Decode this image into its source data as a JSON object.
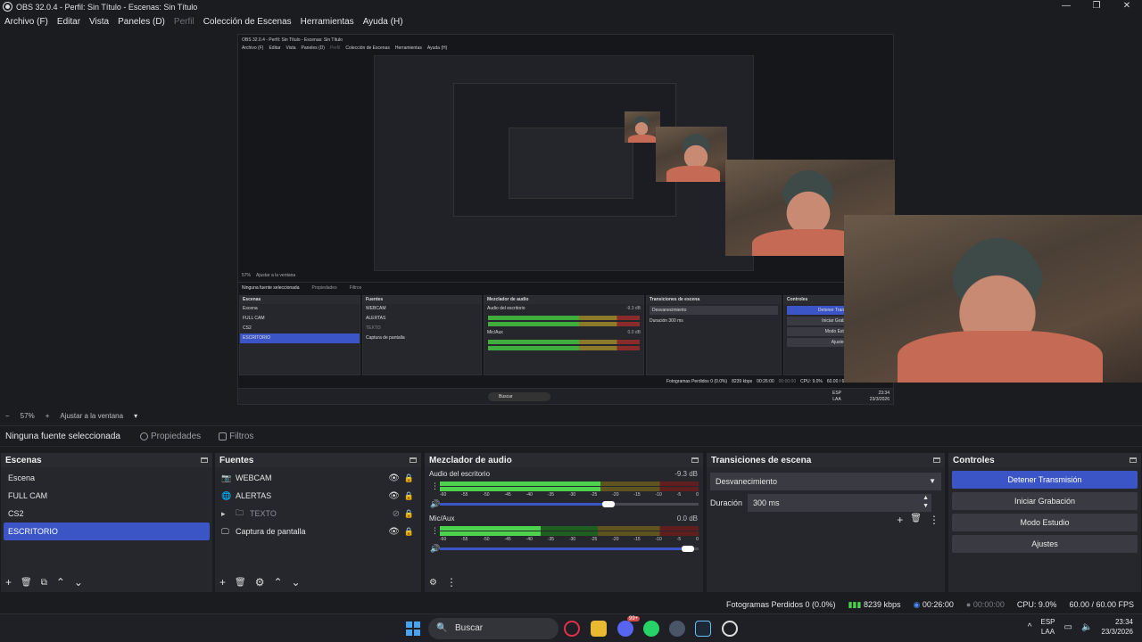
{
  "window": {
    "title": "OBS 32.0.4 - Perfil: Sin Título - Escenas: Sin Título",
    "controls": [
      "—",
      "❐",
      "✕"
    ]
  },
  "menu": [
    {
      "label": "Archivo (F)",
      "enabled": true
    },
    {
      "label": "Editar",
      "enabled": true
    },
    {
      "label": "Vista",
      "enabled": true
    },
    {
      "label": "Paneles (D)",
      "enabled": true
    },
    {
      "label": "Perfil",
      "enabled": false
    },
    {
      "label": "Colección de Escenas",
      "enabled": true
    },
    {
      "label": "Herramientas",
      "enabled": true
    },
    {
      "label": "Ayuda (H)",
      "enabled": true
    }
  ],
  "zoom": {
    "minus": "−",
    "value": "57%",
    "plus": "+",
    "fit_label": "Ajustar a la ventana",
    "caret": "▾"
  },
  "source_toolbar": {
    "no_source": "Ninguna fuente seleccionada",
    "properties": "Propiedades",
    "filters": "Filtros"
  },
  "scenes": {
    "title": "Escenas",
    "items": [
      {
        "label": "Escena",
        "selected": false
      },
      {
        "label": "FULL CAM",
        "selected": false
      },
      {
        "label": "CS2",
        "selected": false
      },
      {
        "label": "ESCRITORIO",
        "selected": true
      }
    ],
    "footer": [
      "+",
      "🗑",
      "⧉",
      "⌃",
      "⌄"
    ]
  },
  "sources": {
    "title": "Fuentes",
    "items": [
      {
        "label": "WEBCAM",
        "icon": "camera-icon",
        "glyph": "📷",
        "visible": true,
        "group": false
      },
      {
        "label": "ALERTAS",
        "icon": "globe-icon",
        "glyph": "🌐",
        "visible": true,
        "group": false
      },
      {
        "label": "TEXTO",
        "icon": "folder-icon",
        "glyph": "🗀",
        "visible": false,
        "group": true
      },
      {
        "label": "Captura de pantalla",
        "icon": "monitor-icon",
        "glyph": "🖵",
        "visible": true,
        "group": false
      }
    ],
    "footer": [
      "+",
      "🗑",
      "⚙",
      "⌃",
      "⌄"
    ]
  },
  "mixer": {
    "title": "Mezclador de audio",
    "ticks": [
      "-60",
      "-55",
      "-50",
      "-45",
      "-40",
      "-35",
      "-30",
      "-25",
      "-20",
      "-15",
      "-10",
      "-5",
      "0"
    ],
    "channels": [
      {
        "name": "Audio del escritorio",
        "db": "-9.3 dB",
        "level": 0.62,
        "volume": 0.65
      },
      {
        "name": "Mic/Aux",
        "db": "0.0 dB",
        "level": 0.39,
        "volume": 0.96
      }
    ],
    "footer": [
      "⚙",
      "⋮"
    ]
  },
  "transitions": {
    "title": "Transiciones de escena",
    "selected": "Desvanecimiento",
    "duration_label": "Duración",
    "duration_value": "300 ms",
    "tools": [
      "+",
      "🗑",
      "⋮"
    ]
  },
  "controls": {
    "title": "Controles",
    "buttons": [
      {
        "label": "Detener Transmisión",
        "active": true
      },
      {
        "label": "Iniciar Grabación",
        "active": false
      },
      {
        "label": "Modo Estudio",
        "active": false
      },
      {
        "label": "Ajustes",
        "active": false
      }
    ]
  },
  "status": {
    "dropped": "Fotogramas Perdidos 0 (0.0%)",
    "bitrate": "8239 kbps",
    "stream_time": "00:26:00",
    "rec_time": "00:00:00",
    "cpu": "CPU: 9.0%",
    "fps": "60.00 / 60.00 FPS"
  },
  "taskbar": {
    "search": "Buscar",
    "lang_top": "ESP",
    "lang_bottom": "LAA",
    "time": "23:34",
    "date": "23/3/2026",
    "tray_caret": "^",
    "badge": "99+"
  },
  "colors": {
    "accent": "#3b55c6",
    "meter_green": "#4cd24c",
    "meter_yellow": "#8c7a2a",
    "meter_red": "#8a2b2b",
    "background": "#1b1c20",
    "panel": "#26272d"
  },
  "nested_preview": {
    "title": "OBS 32.0.4 - Perfil: Sin Título - Escenas: Sin Título",
    "menu": [
      "Archivo (F)",
      "Editar",
      "Vista",
      "Paneles (D)",
      "Perfil",
      "Colección de Escenas",
      "Herramientas",
      "Ayuda (H)"
    ],
    "zoom": "57%",
    "zoom_fit": "Ajustar a la ventana",
    "no_source": "Ninguna fuente seleccionada",
    "properties": "Propiedades",
    "filters": "Filtros",
    "dock_titles": [
      "Escenas",
      "Fuentes",
      "Mezclador de audio",
      "Transiciones de escena",
      "Controles"
    ],
    "scenes": [
      "Escena",
      "FULL CAM",
      "CS2",
      "ESCRITORIO"
    ],
    "sources": [
      "WEBCAM",
      "ALERTAS",
      "TEXTO",
      "Captura de pantalla"
    ],
    "mixer_channels": [
      {
        "name": "Audio del escritorio",
        "db": "-9.3 dB"
      },
      {
        "name": "Mic/Aux",
        "db": "0.0 dB"
      }
    ],
    "transition": "Desvanecimiento",
    "duration_label": "Duración",
    "duration_value": "300 ms",
    "controls": [
      "Detener Transmisión",
      "Iniciar Grabación",
      "Modo Estudio",
      "Ajustes"
    ],
    "status": [
      "Fotogramas Perdidos 0 (0.0%)",
      "8239 kbps",
      "00:26:00",
      "00:00:00",
      "CPU: 9.0%",
      "60.00 / 60.00 FPS"
    ],
    "taskbar_search": "Buscar",
    "lang_top": "ESP",
    "lang_bottom": "LAA",
    "time": "23:34",
    "date": "23/3/2026"
  }
}
